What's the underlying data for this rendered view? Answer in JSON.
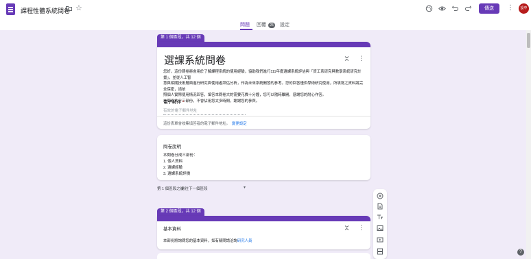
{
  "header": {
    "doc_title": "課程性體系統問卷",
    "send_label": "傳送",
    "avatar_text": "設中"
  },
  "tabs": [
    {
      "label": "問題",
      "active": true
    },
    {
      "label": "回覆",
      "badge": "25",
      "active": false
    },
    {
      "label": "設定",
      "active": false
    }
  ],
  "section1": {
    "tag": "第 1 個區段，共 12 個",
    "title": "選課系統問卷",
    "description_lines": [
      "您好，這份問卷將會用於了解課程系統的使用經驗，協助我們進行111年度選課系統評估與「資工系研究與教學系統研究計畫」，並從人工智",
      "慧與相關技術層面進行研究與使用者評估分析，作為未來系統開發的參考。您的回答僅供學術研究使用，所填寫之資料將完全保密，請依",
      "照個人實際使用情況回答，填答本問卷大約需要花費十分鐘，您可以隨時離開，感謝您的耐心作答。",
      "本問卷共分三部份，不會佔用您太多時間，謝謝您的參與。"
    ],
    "email_label": "電子郵件",
    "email_required": "*",
    "email_placeholder": "有效的電子郵件地址",
    "email_note": "這份表單會收集填答者的電子郵件地址。",
    "email_note_link": "變更設定"
  },
  "text_card": {
    "title": "問卷說明",
    "lines": [
      "本問卷分成三部份：",
      "1. 個人資料",
      "2. 選課經驗",
      "3. 選課系統評價"
    ]
  },
  "after_section": {
    "label": "第 1 個區段之後",
    "select_value": "前往下一個區段"
  },
  "section2": {
    "tag": "第 2 個區段，共 12 個",
    "title": "基本資料",
    "description": "本部份將詢問您的基本資料，如有疑問請洽詢",
    "description_link": "研究人員"
  },
  "toolbar": {
    "icons": [
      "add-question-icon",
      "import-questions-icon",
      "add-title-icon",
      "add-image-icon",
      "add-video-icon",
      "add-section-icon"
    ]
  },
  "colors": {
    "accent": "#673ab7",
    "background": "#f0ebf8",
    "link": "#1a73e8",
    "required": "#d93025"
  }
}
